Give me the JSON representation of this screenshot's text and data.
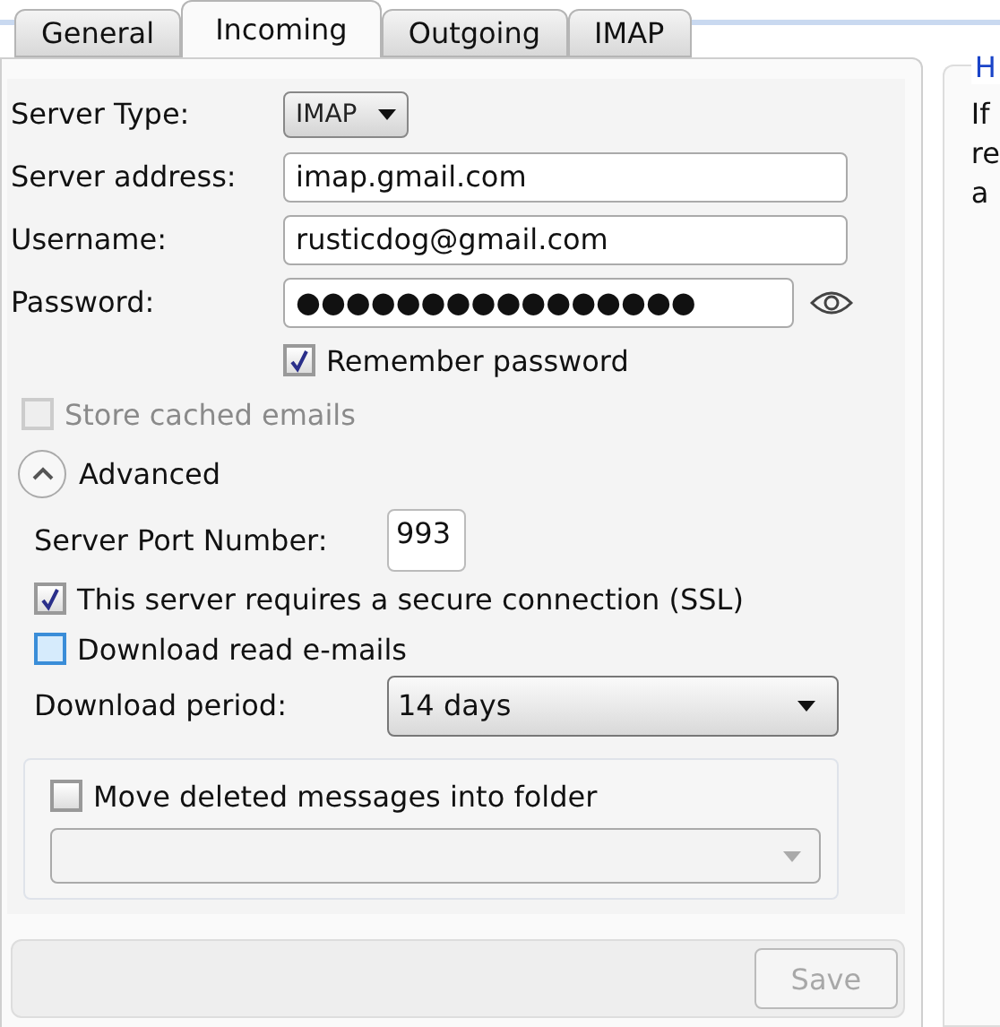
{
  "tabs": [
    {
      "label": "General",
      "selected": false
    },
    {
      "label": "Incoming",
      "selected": true
    },
    {
      "label": "Outgoing",
      "selected": false
    },
    {
      "label": "IMAP",
      "selected": false
    }
  ],
  "account": {
    "fields": [
      {
        "kind": "select",
        "label": "Server Type:",
        "value": "IMAP"
      },
      {
        "kind": "text",
        "label": "Server address:",
        "value": "imap.gmail.com"
      },
      {
        "kind": "text",
        "label": "Username:",
        "value": "rusticdog@gmail.com"
      },
      {
        "kind": "password",
        "label": "Password:",
        "value": "●●●●●●●●●●●●●●●●"
      }
    ],
    "remember_password": {
      "label": "Remember password",
      "checked": true,
      "disabled": false
    }
  },
  "store_cached": {
    "label": "Store cached emails",
    "checked": false,
    "disabled": true
  },
  "advanced": {
    "label": "Advanced",
    "expanded": true,
    "port": {
      "label": "Server Port Number:",
      "value": "993"
    },
    "options": [
      {
        "label": "This server requires a secure connection (SSL)",
        "checked": true,
        "disabled": false,
        "focused": false
      },
      {
        "label": "Download read e-mails",
        "checked": false,
        "disabled": false,
        "focused": true
      }
    ],
    "period": {
      "label": "Download period:",
      "value": "14 days"
    },
    "move_deleted": {
      "label": "Move deleted messages into folder",
      "checked": false,
      "disabled": false,
      "folder_disabled": true
    }
  },
  "save": {
    "label": "Save",
    "disabled": true
  },
  "help": {
    "heading": "H",
    "lines": [
      "If",
      "re",
      "a"
    ]
  }
}
